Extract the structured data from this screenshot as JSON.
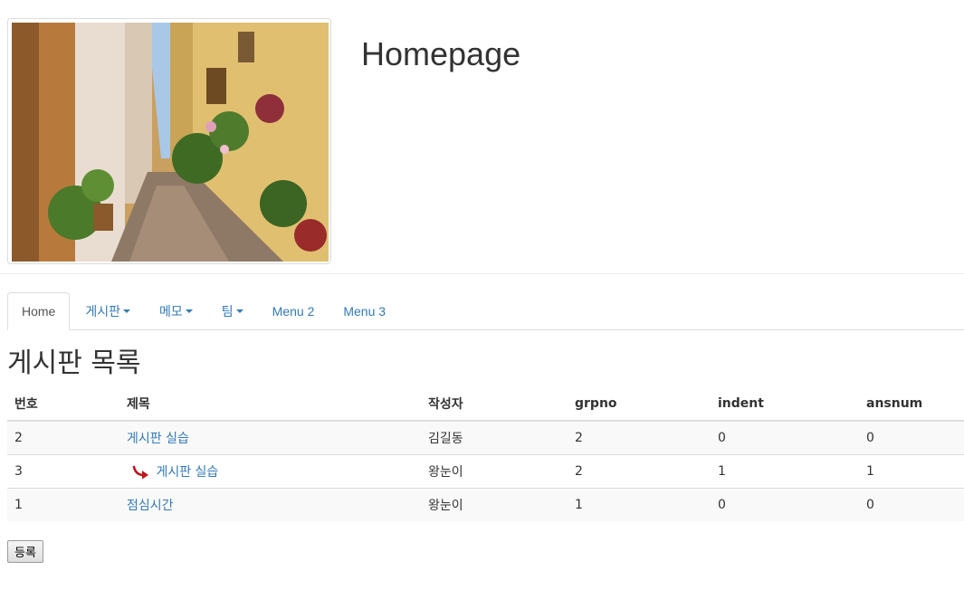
{
  "header": {
    "title": "Homepage",
    "image_icon": "street-photo"
  },
  "nav": {
    "tabs": [
      {
        "label": "Home",
        "active": true,
        "dropdown": false
      },
      {
        "label": "게시판",
        "active": false,
        "dropdown": true
      },
      {
        "label": "메모",
        "active": false,
        "dropdown": true
      },
      {
        "label": "팀",
        "active": false,
        "dropdown": true
      },
      {
        "label": "Menu 2",
        "active": false,
        "dropdown": false
      },
      {
        "label": "Menu 3",
        "active": false,
        "dropdown": false
      }
    ]
  },
  "main": {
    "title": "게시판 목록",
    "table": {
      "columns": [
        "번호",
        "제목",
        "작성자",
        "grpno",
        "indent",
        "ansnum"
      ],
      "rows": [
        {
          "no": "2",
          "title": "게시판 실습",
          "writer": "김길동",
          "grpno": "2",
          "indent": "0",
          "ansnum": "0",
          "is_reply": false
        },
        {
          "no": "3",
          "title": "게시판 실습",
          "writer": "왕눈이",
          "grpno": "2",
          "indent": "1",
          "ansnum": "1",
          "is_reply": true
        },
        {
          "no": "1",
          "title": "점심시간",
          "writer": "왕눈이",
          "grpno": "1",
          "indent": "0",
          "ansnum": "0",
          "is_reply": false
        }
      ]
    },
    "register_label": "등록"
  },
  "colors": {
    "link": "#337ab7",
    "reply_arrow": "#c0151b",
    "row_stripe": "#f9f9f9",
    "border": "#dddddd"
  },
  "icons": {
    "reply": "reply-arrow-icon",
    "dropdown": "caret-down-icon"
  }
}
